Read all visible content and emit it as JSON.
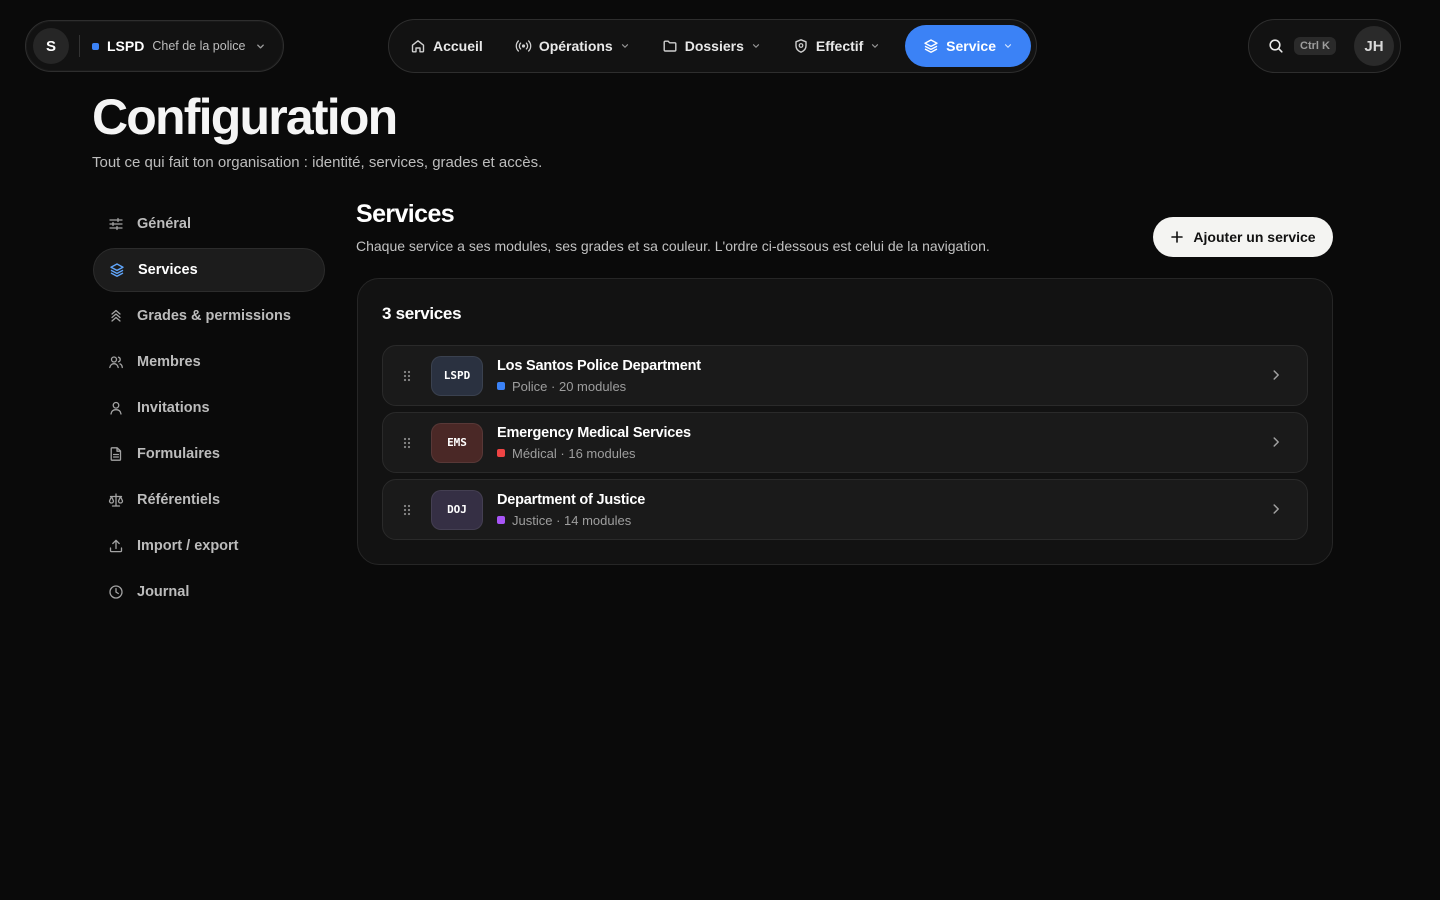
{
  "org": {
    "initial": "S",
    "code": "LSPD",
    "role": "Chef de la police",
    "dot_color": "#3b82f6"
  },
  "nav": {
    "items": [
      {
        "label": "Accueil",
        "icon": "home-icon",
        "dropdown": false
      },
      {
        "label": "Opérations",
        "icon": "broadcast-icon",
        "dropdown": true
      },
      {
        "label": "Dossiers",
        "icon": "folder-icon",
        "dropdown": true
      },
      {
        "label": "Effectif",
        "icon": "shield-icon",
        "dropdown": true
      },
      {
        "label": "Service",
        "icon": "layers-icon",
        "dropdown": true,
        "active": true
      }
    ],
    "active_color": "#3b82f6"
  },
  "topright": {
    "shortcut": "Ctrl K",
    "user_initials": "JH"
  },
  "header": {
    "title": "Configuration",
    "subtitle": "Tout ce qui fait ton organisation : identité, services, grades et accès."
  },
  "sidebar": {
    "items": [
      {
        "label": "Général",
        "icon": "sliders-icon"
      },
      {
        "label": "Services",
        "icon": "layers-icon",
        "active": true
      },
      {
        "label": "Grades & permissions",
        "icon": "chevrons-up-icon"
      },
      {
        "label": "Membres",
        "icon": "users-icon"
      },
      {
        "label": "Invitations",
        "icon": "user-icon"
      },
      {
        "label": "Formulaires",
        "icon": "file-icon"
      },
      {
        "label": "Référentiels",
        "icon": "scale-icon"
      },
      {
        "label": "Import / export",
        "icon": "upload-icon"
      },
      {
        "label": "Journal",
        "icon": "clock-icon"
      }
    ]
  },
  "services_section": {
    "title": "Services",
    "subtitle": "Chaque service a ses modules, ses grades et sa couleur. L'ordre ci-dessous est celui de la navigation.",
    "add_button": "Ajouter un service",
    "count_label": "3 services",
    "services": [
      {
        "badge": "LSPD",
        "name": "Los Santos Police Department",
        "meta": "Police · 20 modules",
        "color": "#3b82f6",
        "badge_bg": "#2a3140"
      },
      {
        "badge": "EMS",
        "name": "Emergency Medical Services",
        "meta": "Médical · 16 modules",
        "color": "#ef4444",
        "badge_bg": "#4a2826"
      },
      {
        "badge": "DOJ",
        "name": "Department of Justice",
        "meta": "Justice · 14 modules",
        "color": "#a855f7",
        "badge_bg": "#352f44"
      }
    ]
  }
}
